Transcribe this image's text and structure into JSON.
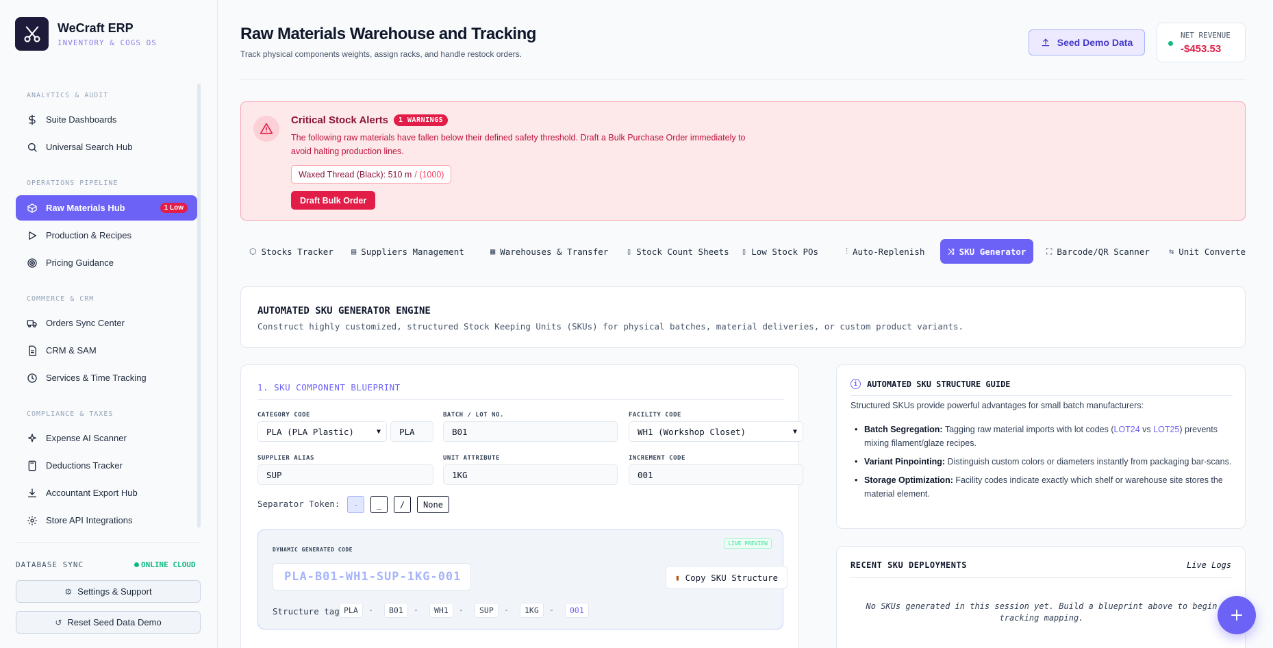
{
  "brand": {
    "name": "WeCraft ERP",
    "subtitle": "INVENTORY & COGS OS"
  },
  "sidebar": {
    "sections": [
      {
        "label": "ANALYTICS & AUDIT",
        "items": [
          {
            "label": "Suite Dashboards",
            "icon": "dollar-icon"
          },
          {
            "label": "Universal Search Hub",
            "icon": "search-icon"
          }
        ]
      },
      {
        "label": "OPERATIONS PIPELINE",
        "items": [
          {
            "label": "Raw Materials Hub",
            "icon": "box-icon",
            "badge": "1 Low",
            "active": true
          },
          {
            "label": "Production & Recipes",
            "icon": "play-icon"
          },
          {
            "label": "Pricing Guidance",
            "icon": "target-icon"
          }
        ]
      },
      {
        "label": "COMMERCE & CRM",
        "items": [
          {
            "label": "Orders Sync Center",
            "icon": "truck-icon"
          },
          {
            "label": "CRM & SAM",
            "icon": "document-icon"
          },
          {
            "label": "Services & Time Tracking",
            "icon": "clock-icon"
          }
        ]
      },
      {
        "label": "COMPLIANCE & TAXES",
        "items": [
          {
            "label": "Expense AI Scanner",
            "icon": "sparkle-icon"
          },
          {
            "label": "Deductions Tracker",
            "icon": "calculator-icon"
          },
          {
            "label": "Accountant Export Hub",
            "icon": "download-icon"
          },
          {
            "label": "Store API Integrations",
            "icon": "gear-icon"
          }
        ]
      }
    ],
    "db_sync_label": "DATABASE SYNC",
    "db_status": "ONLINE CLOUD",
    "settings_label": "Settings & Support",
    "reset_label": "Reset Seed Data Demo"
  },
  "header": {
    "title": "Raw Materials Warehouse and Tracking",
    "subtitle": "Track physical components weights, assign racks, and handle restock orders.",
    "seed_label": "Seed Demo Data",
    "revenue_label": "NET REVENUE",
    "revenue_value": "-$453.53"
  },
  "alert": {
    "title": "Critical Stock Alerts",
    "badge": "1 WARNINGS",
    "description": "The following raw materials have fallen below their defined safety threshold. Draft a Bulk Purchase Order immediately to avoid halting production lines.",
    "chip_text": "Waxed Thread (Black): 510 m",
    "chip_limit": "/ (1000)",
    "button": "Draft Bulk Order"
  },
  "tabs": [
    {
      "label": "Stocks Tracker",
      "icon": "cube-icon"
    },
    {
      "label": "Suppliers Management",
      "icon": "building-icon"
    },
    {
      "label": "Warehouses & Transfer",
      "icon": "warehouse-icon"
    },
    {
      "label": "Stock Count Sheets",
      "icon": "file-icon"
    },
    {
      "label": "Low Stock POs",
      "icon": "file-list-icon"
    },
    {
      "label": "Auto-Replenish",
      "icon": "sliders-icon"
    },
    {
      "label": "SKU Generator",
      "icon": "shuffle-icon",
      "active": true
    },
    {
      "label": "Barcode/QR Scanner",
      "icon": "scan-icon"
    },
    {
      "label": "Unit Converter",
      "icon": "arrows-icon"
    }
  ],
  "engine": {
    "title": "AUTOMATED SKU GENERATOR ENGINE",
    "description": "Construct highly customized, structured Stock Keeping Units (SKUs) for physical batches, material deliveries, or custom product variants."
  },
  "blueprint": {
    "title": "1. SKU COMPONENT BLUEPRINT",
    "category_label": "CATEGORY CODE",
    "category_value": "PLA (PLA Plastic)",
    "category_code": "PLA",
    "batch_label": "BATCH / LOT NO.",
    "batch_value": "B01",
    "facility_label": "FACILITY CODE",
    "facility_value": "WH1 (Workshop Closet)",
    "supplier_label": "SUPPLIER ALIAS",
    "supplier_value": "SUP",
    "unit_label": "UNIT ATTRIBUTE",
    "unit_value": "1KG",
    "increment_label": "INCREMENT CODE",
    "increment_value": "001",
    "separator_label": "Separator Token:",
    "separators": [
      "-",
      "_",
      "/",
      "None"
    ]
  },
  "preview": {
    "label": "DYNAMIC GENERATED CODE",
    "badge": "LIVE PREVIEW",
    "code": "PLA-B01-WH1-SUP-1KG-001",
    "copy_label": "Copy SKU Structure",
    "tags_label": "Structure tags:",
    "tags": [
      "PLA",
      "B01",
      "WH1",
      "SUP",
      "1KG",
      "001"
    ],
    "tag_separator": "-"
  },
  "guide": {
    "title": "AUTOMATED SKU STRUCTURE GUIDE",
    "intro": "Structured SKUs provide powerful advantages for small batch manufacturers:",
    "items": [
      {
        "bold": "Batch Segregation:",
        "pre": " Tagging raw material imports with lot codes (",
        "l1": "LOT24",
        "mid": " vs ",
        "l2": "LOT25",
        "post": ") prevents mixing filament/glaze recipes."
      },
      {
        "bold": "Variant Pinpointing:",
        "text": " Distinguish custom colors or diameters instantly from packaging bar-scans."
      },
      {
        "bold": "Storage Optimization:",
        "text": " Facility codes indicate exactly which shelf or warehouse site stores the material element."
      }
    ]
  },
  "recent": {
    "title": "RECENT SKU DEPLOYMENTS",
    "live": "Live Logs",
    "empty": "No SKUs generated in this session yet. Build a blueprint above to begin tracking mapping."
  },
  "colors": {
    "accent": "#6d62f6",
    "danger": "#e11d48",
    "success": "#10b981"
  }
}
